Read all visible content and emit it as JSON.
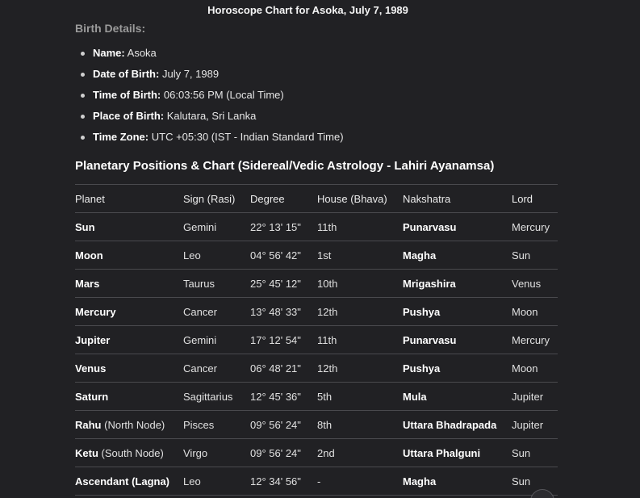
{
  "title": "Horoscope Chart for Asoka, July 7, 1989",
  "birth_details": {
    "heading": "Birth Details:",
    "items": [
      {
        "label": "Name:",
        "value": "Asoka"
      },
      {
        "label": "Date of Birth:",
        "value": "July 7, 1989"
      },
      {
        "label": "Time of Birth:",
        "value": "06:03:56 PM (Local Time)"
      },
      {
        "label": "Place of Birth:",
        "value": "Kalutara, Sri Lanka"
      },
      {
        "label": "Time Zone:",
        "value": "UTC +05:30 (IST - Indian Standard Time)"
      }
    ]
  },
  "positions": {
    "heading": "Planetary Positions & Chart (Sidereal/Vedic Astrology - Lahiri Ayanamsa)",
    "columns": [
      "Planet",
      "Sign (Rasi)",
      "Degree",
      "House (Bhava)",
      "Nakshatra",
      "Lord"
    ],
    "rows": [
      {
        "planet": "Sun",
        "note": "",
        "sign": "Gemini",
        "degree": "22° 13' 15\"",
        "house": "11th",
        "nakshatra": "Punarvasu",
        "lord": "Mercury"
      },
      {
        "planet": "Moon",
        "note": "",
        "sign": "Leo",
        "degree": "04° 56' 42\"",
        "house": "1st",
        "nakshatra": "Magha",
        "lord": "Sun"
      },
      {
        "planet": "Mars",
        "note": "",
        "sign": "Taurus",
        "degree": "25° 45' 12\"",
        "house": "10th",
        "nakshatra": "Mrigashira",
        "lord": "Venus"
      },
      {
        "planet": "Mercury",
        "note": "",
        "sign": "Cancer",
        "degree": "13° 48' 33\"",
        "house": "12th",
        "nakshatra": "Pushya",
        "lord": "Moon"
      },
      {
        "planet": "Jupiter",
        "note": "",
        "sign": "Gemini",
        "degree": "17° 12' 54\"",
        "house": "11th",
        "nakshatra": "Punarvasu",
        "lord": "Mercury"
      },
      {
        "planet": "Venus",
        "note": "",
        "sign": "Cancer",
        "degree": "06° 48' 21\"",
        "house": "12th",
        "nakshatra": "Pushya",
        "lord": "Moon"
      },
      {
        "planet": "Saturn",
        "note": "",
        "sign": "Sagittarius",
        "degree": "12° 45' 36\"",
        "house": "5th",
        "nakshatra": "Mula",
        "lord": "Jupiter"
      },
      {
        "planet": "Rahu",
        "note": "(North Node)",
        "sign": "Pisces",
        "degree": "09° 56' 24\"",
        "house": "8th",
        "nakshatra": "Uttara Bhadrapada",
        "lord": "Jupiter"
      },
      {
        "planet": "Ketu",
        "note": "(South Node)",
        "sign": "Virgo",
        "degree": "09° 56' 24\"",
        "house": "2nd",
        "nakshatra": "Uttara Phalguni",
        "lord": "Sun"
      },
      {
        "planet": "Ascendant (Lagna)",
        "note": "",
        "sign": "Leo",
        "degree": "12° 34' 56\"",
        "house": "-",
        "nakshatra": "Magha",
        "lord": "Sun"
      }
    ]
  }
}
